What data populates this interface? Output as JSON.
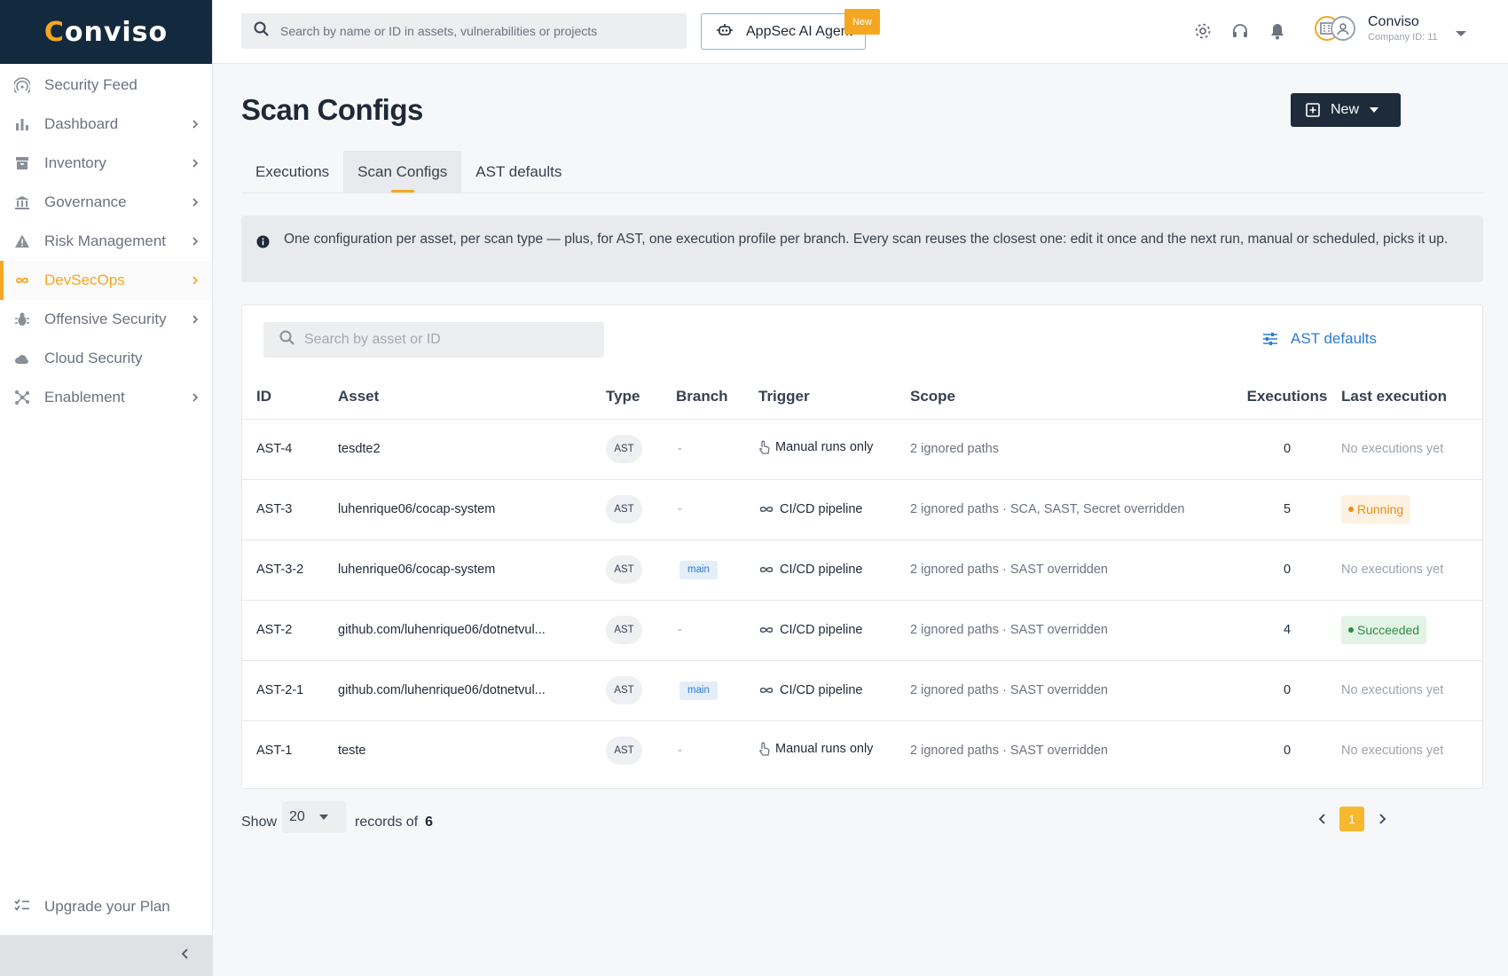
{
  "app": {
    "logo_prefix": "C",
    "logo_rest": "onviso"
  },
  "sidebar": {
    "items": [
      {
        "label": "Security Feed",
        "icon": "radar-icon",
        "chevron": false,
        "active": false
      },
      {
        "label": "Dashboard",
        "icon": "bar-chart-icon",
        "chevron": true,
        "active": false
      },
      {
        "label": "Inventory",
        "icon": "archive-icon",
        "chevron": true,
        "active": false
      },
      {
        "label": "Governance",
        "icon": "bank-icon",
        "chevron": true,
        "active": false
      },
      {
        "label": "Risk Management",
        "icon": "warning-icon",
        "chevron": true,
        "active": false
      },
      {
        "label": "DevSecOps",
        "icon": "infinity-icon",
        "chevron": true,
        "active": true
      },
      {
        "label": "Offensive Security",
        "icon": "bug-icon",
        "chevron": true,
        "active": false
      },
      {
        "label": "Cloud Security",
        "icon": "cloud-icon",
        "chevron": false,
        "active": false
      },
      {
        "label": "Enablement",
        "icon": "hub-icon",
        "chevron": true,
        "active": false
      }
    ],
    "upgrade_label": "Upgrade your Plan"
  },
  "topbar": {
    "search_placeholder": "Search by name or ID in assets, vulnerabilities or projects",
    "ai_button_label": "AppSec AI Agent",
    "new_badge": "New",
    "user_name": "Conviso",
    "company_id": "Company ID: 11"
  },
  "page": {
    "title": "Scan Configs",
    "new_button_label": "New",
    "tabs": [
      {
        "label": "Executions",
        "active": false
      },
      {
        "label": "Scan Configs",
        "active": true
      },
      {
        "label": "AST defaults",
        "active": false
      }
    ],
    "info_text": "One configuration per asset, per scan type — plus, for AST, one execution profile per branch. Every scan reuses the closest one: edit it once and the next run, manual or scheduled, picks it up."
  },
  "table": {
    "search_placeholder": "Search by asset or ID",
    "ast_defaults_link": "AST defaults",
    "columns": [
      "ID",
      "Asset",
      "Type",
      "Branch",
      "Trigger",
      "Scope",
      "Executions",
      "Last execution"
    ],
    "rows": [
      {
        "id": "AST-4",
        "asset": "tesdte2",
        "type": "AST",
        "branch": "-",
        "trigger": "Manual runs only",
        "trigger_icon": "hand-icon",
        "scope": "2 ignored paths",
        "executions": "0",
        "last": "No executions yet",
        "status": "none"
      },
      {
        "id": "AST-3",
        "asset": "luhenrique06/cocap-system",
        "type": "AST",
        "branch": "-",
        "trigger": "CI/CD pipeline",
        "trigger_icon": "infinity-icon",
        "scope": "2 ignored paths · SCA, SAST, Secret overridden",
        "executions": "5",
        "last": "Running",
        "status": "running"
      },
      {
        "id": "AST-3-2",
        "asset": "luhenrique06/cocap-system",
        "type": "AST",
        "branch": "main",
        "trigger": "CI/CD pipeline",
        "trigger_icon": "infinity-icon",
        "scope": "2 ignored paths · SAST overridden",
        "executions": "0",
        "last": "No executions yet",
        "status": "none"
      },
      {
        "id": "AST-2",
        "asset": "github.com/luhenrique06/dotnetvul...",
        "type": "AST",
        "branch": "-",
        "trigger": "CI/CD pipeline",
        "trigger_icon": "infinity-icon",
        "scope": "2 ignored paths · SAST overridden",
        "executions": "4",
        "last": "Succeeded",
        "status": "succeeded"
      },
      {
        "id": "AST-2-1",
        "asset": "github.com/luhenrique06/dotnetvul...",
        "type": "AST",
        "branch": "main",
        "trigger": "CI/CD pipeline",
        "trigger_icon": "infinity-icon",
        "scope": "2 ignored paths · SAST overridden",
        "executions": "0",
        "last": "No executions yet",
        "status": "none"
      },
      {
        "id": "AST-1",
        "asset": "teste",
        "type": "AST",
        "branch": "-",
        "trigger": "Manual runs only",
        "trigger_icon": "hand-icon",
        "scope": "2 ignored paths · SAST overridden",
        "executions": "0",
        "last": "No executions yet",
        "status": "none"
      }
    ]
  },
  "pagination": {
    "show_label": "Show",
    "page_size": "20",
    "records_label": "records of",
    "total": "6",
    "current_page": "1"
  },
  "colors": {
    "accent": "#f5a623",
    "navy": "#13293d",
    "link": "#2b7cd3"
  }
}
